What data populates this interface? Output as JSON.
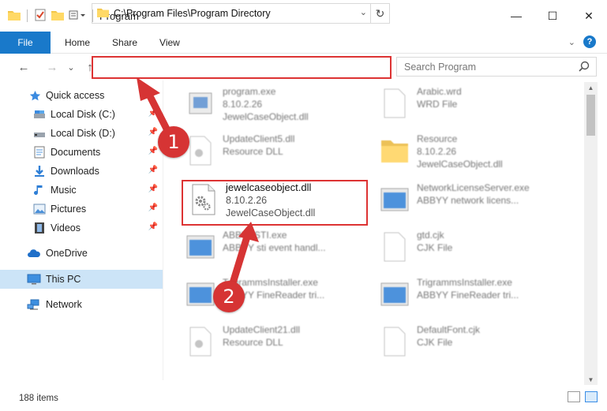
{
  "window": {
    "title": "Program",
    "minimize": "—",
    "maximize": "☐",
    "close": "✕"
  },
  "ribbon": {
    "file": "File",
    "tabs": [
      "Home",
      "Share",
      "View"
    ],
    "help": "?"
  },
  "nav": {
    "back": "←",
    "forward": "→",
    "recent": "⌄",
    "up": "↑",
    "address_path": "C:\\Program Files\\Program Directory",
    "refresh": "↻",
    "search_placeholder": "Search Program"
  },
  "sidebar": {
    "items": [
      {
        "label": "Quick access",
        "icon": "star-icon",
        "pinned": false
      },
      {
        "label": "Local Disk (C:)",
        "icon": "drive-icon",
        "pinned": true
      },
      {
        "label": "Local Disk (D:)",
        "icon": "drive-icon",
        "pinned": true
      },
      {
        "label": "Documents",
        "icon": "documents-icon",
        "pinned": true
      },
      {
        "label": "Downloads",
        "icon": "downloads-icon",
        "pinned": true
      },
      {
        "label": "Music",
        "icon": "music-icon",
        "pinned": true
      },
      {
        "label": "Pictures",
        "icon": "pictures-icon",
        "pinned": true
      },
      {
        "label": "Videos",
        "icon": "videos-icon",
        "pinned": true
      },
      {
        "label": "OneDrive",
        "icon": "onedrive-icon",
        "pinned": false
      },
      {
        "label": "This PC",
        "icon": "computer-icon",
        "pinned": false
      },
      {
        "label": "Network",
        "icon": "network-icon",
        "pinned": false
      }
    ],
    "pin_glyph": "📌"
  },
  "files": [
    {
      "name": "program.exe",
      "line2": "8.10.2.26",
      "line3": "JewelCaseObject.dll",
      "icon": "exe-icon"
    },
    {
      "name": "Arabic.wrd",
      "line2": "WRD File",
      "line3": "",
      "icon": "blank-file-icon"
    },
    {
      "name": "UpdateClient5.dll",
      "line2": "Resource DLL",
      "line3": "",
      "icon": "dll-icon"
    },
    {
      "name": "Resource",
      "line2": "8.10.2.26",
      "line3": "JewelCaseObject.dll",
      "icon": "folder-icon"
    },
    {
      "name": "jewelcaseobject.dll",
      "line2": "8.10.2.26",
      "line3": "JewelCaseObject.dll",
      "icon": "dll-gear-icon"
    },
    {
      "name": "NetworkLicenseServer.exe",
      "line2": "ABBYY network licens...",
      "line3": "",
      "icon": "app-window-icon"
    },
    {
      "name": "ABBYYSTI.exe",
      "line2": "ABBYY sti event handl...",
      "line3": "",
      "icon": "app-window-icon"
    },
    {
      "name": "gtd.cjk",
      "line2": "CJK File",
      "line3": "",
      "icon": "blank-file-icon"
    },
    {
      "name": "TrigrammsInstaller.exe",
      "line2": "ABBYY FineReader tri...",
      "line3": "",
      "icon": "app-window-icon"
    },
    {
      "name": "TrigrammsInstaller.exe",
      "line2": "ABBYY FineReader tri...",
      "line3": "",
      "icon": "app-window-icon"
    },
    {
      "name": "UpdateClient21.dll",
      "line2": "Resource DLL",
      "line3": "",
      "icon": "dll-icon"
    },
    {
      "name": "DefaultFont.cjk",
      "line2": "CJK File",
      "line3": "",
      "icon": "blank-file-icon"
    }
  ],
  "status": {
    "item_count": "188 items"
  },
  "annotations": {
    "step1": "1",
    "step2": "2",
    "color": "#d63434"
  },
  "colors": {
    "accent": "#1979ca",
    "selected": "#cce4f7",
    "highlight": "#d33333"
  }
}
